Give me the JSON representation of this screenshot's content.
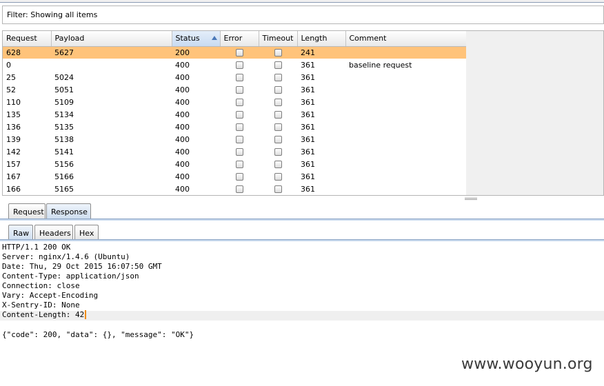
{
  "filter": {
    "text": "Filter: Showing all items"
  },
  "table": {
    "columns": [
      "Request",
      "Payload",
      "Status",
      "Error",
      "Timeout",
      "Length",
      "Comment"
    ],
    "sorted_column": "Status",
    "sort_direction": "ascending",
    "rows": [
      {
        "request": "628",
        "payload": "5627",
        "status": "200",
        "error": false,
        "timeout": false,
        "length": "241",
        "comment": "",
        "selected": true
      },
      {
        "request": "0",
        "payload": "",
        "status": "400",
        "error": false,
        "timeout": false,
        "length": "361",
        "comment": "baseline request",
        "selected": false
      },
      {
        "request": "25",
        "payload": "5024",
        "status": "400",
        "error": false,
        "timeout": false,
        "length": "361",
        "comment": "",
        "selected": false
      },
      {
        "request": "52",
        "payload": "5051",
        "status": "400",
        "error": false,
        "timeout": false,
        "length": "361",
        "comment": "",
        "selected": false
      },
      {
        "request": "110",
        "payload": "5109",
        "status": "400",
        "error": false,
        "timeout": false,
        "length": "361",
        "comment": "",
        "selected": false
      },
      {
        "request": "135",
        "payload": "5134",
        "status": "400",
        "error": false,
        "timeout": false,
        "length": "361",
        "comment": "",
        "selected": false
      },
      {
        "request": "136",
        "payload": "5135",
        "status": "400",
        "error": false,
        "timeout": false,
        "length": "361",
        "comment": "",
        "selected": false
      },
      {
        "request": "139",
        "payload": "5138",
        "status": "400",
        "error": false,
        "timeout": false,
        "length": "361",
        "comment": "",
        "selected": false
      },
      {
        "request": "142",
        "payload": "5141",
        "status": "400",
        "error": false,
        "timeout": false,
        "length": "361",
        "comment": "",
        "selected": false
      },
      {
        "request": "157",
        "payload": "5156",
        "status": "400",
        "error": false,
        "timeout": false,
        "length": "361",
        "comment": "",
        "selected": false
      },
      {
        "request": "167",
        "payload": "5166",
        "status": "400",
        "error": false,
        "timeout": false,
        "length": "361",
        "comment": "",
        "selected": false
      },
      {
        "request": "166",
        "payload": "5165",
        "status": "400",
        "error": false,
        "timeout": false,
        "length": "361",
        "comment": "",
        "selected": false
      }
    ]
  },
  "message_tabs": {
    "request": "Request",
    "response": "Response",
    "active": "Response"
  },
  "view_tabs": {
    "raw": "Raw",
    "headers": "Headers",
    "hex": "Hex",
    "active": "Raw"
  },
  "response_lines": [
    "HTTP/1.1 200 OK",
    "Server: nginx/1.4.6 (Ubuntu)",
    "Date: Thu, 29 Oct 2015 16:07:50 GMT",
    "Content-Type: application/json",
    "Connection: close",
    "Vary: Accept-Encoding",
    "X-Sentry-ID: None",
    "Content-Length: 42"
  ],
  "response_body": "{\"code\": 200, \"data\": {}, \"message\": \"OK\"}",
  "colors": {
    "selected_row": "#ffc37a",
    "active_tab": "#cfdff0",
    "caret": "#f08a00"
  },
  "watermark": "www.wooyun.org"
}
